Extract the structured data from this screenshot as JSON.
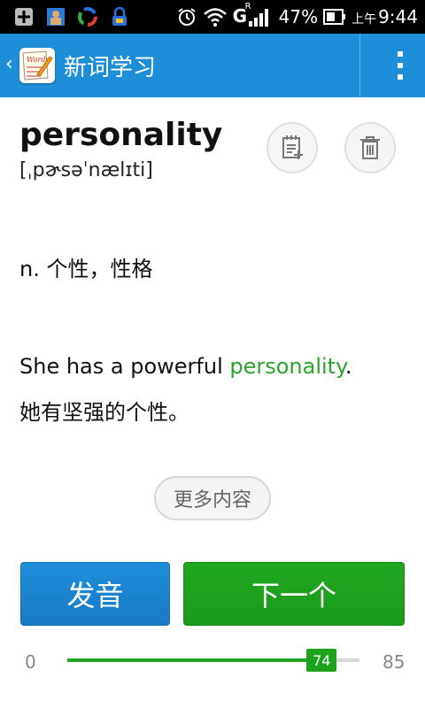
{
  "status_bar": {
    "icons": [
      "add-box-icon",
      "gallery-icon",
      "color-wheel-icon",
      "usb-lock-icon"
    ],
    "right_icons": [
      "alarm-icon",
      "wifi-icon",
      "signal-icon",
      "battery-icon"
    ],
    "network_label": "G",
    "roaming_label": "R",
    "battery_pct": "47%",
    "time_prefix": "上午",
    "time": "9:44"
  },
  "app_bar": {
    "back_glyph": "‹",
    "title": "新词学习",
    "logo_text": "Words",
    "colors": {
      "bar": "#1e8ed8"
    }
  },
  "word": {
    "text": "personality",
    "phonetic": "[ˌpɚsəˈnælɪti]"
  },
  "definition": "n. 个性，性格",
  "example": {
    "en_before": "She has a powerful ",
    "en_highlight": "personality",
    "en_after": ".",
    "zh": "她有坚强的个性。"
  },
  "more_button": "更多内容",
  "buttons": {
    "play": "发音",
    "next": "下一个"
  },
  "progress": {
    "min": "0",
    "max": "85",
    "value": 74,
    "value_label": "74",
    "accent": "#22a322"
  }
}
